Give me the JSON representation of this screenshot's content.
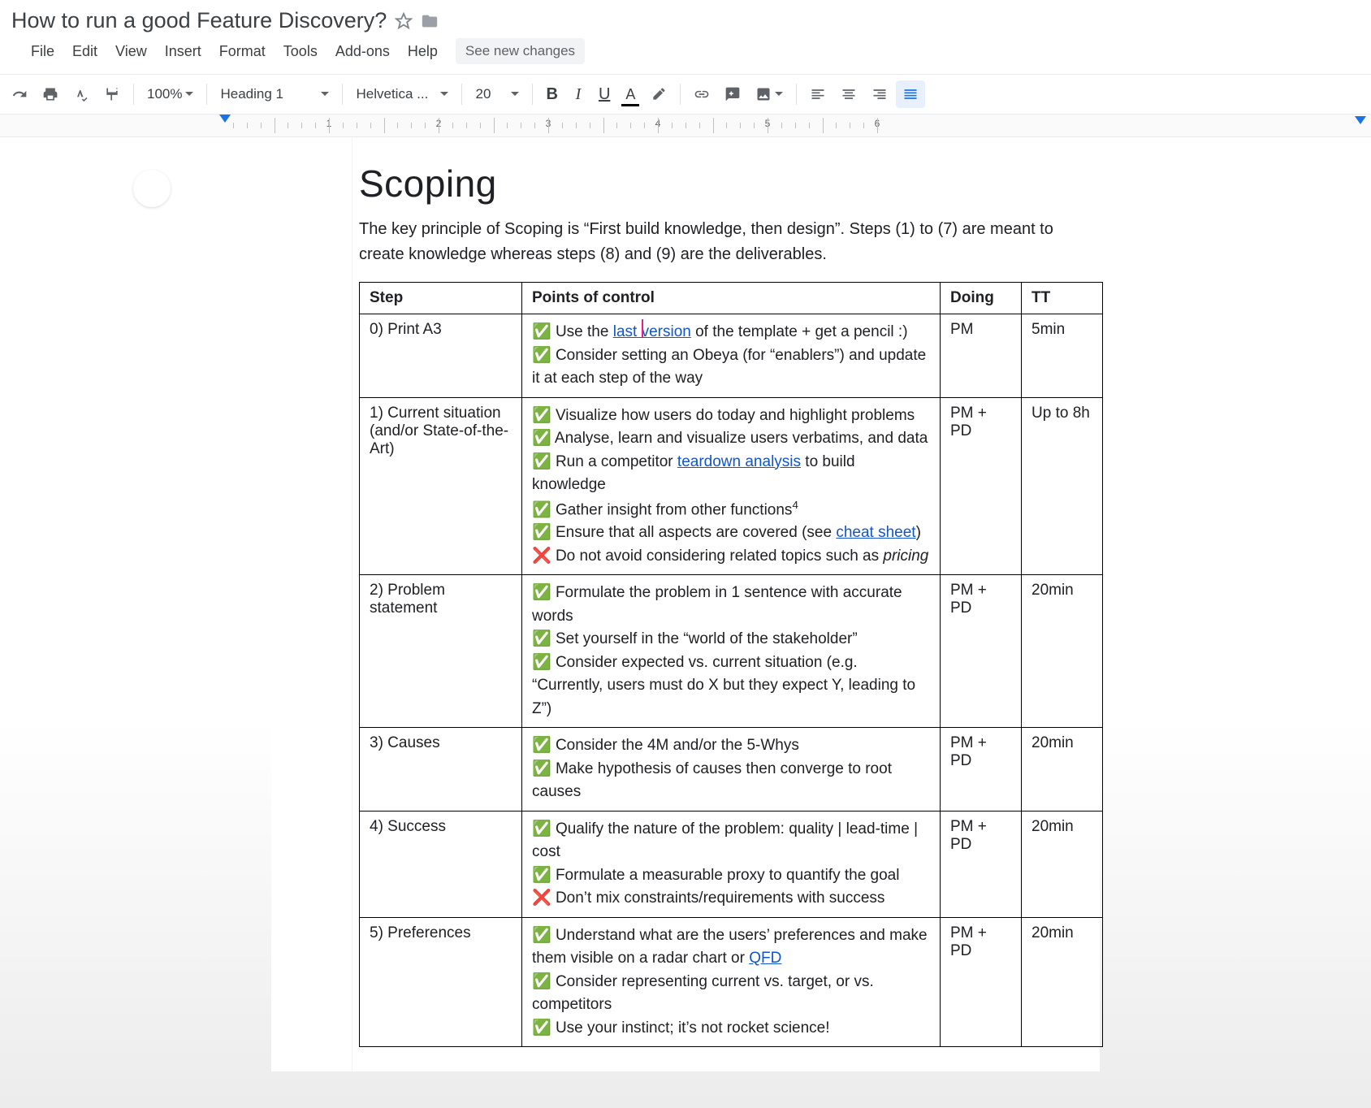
{
  "doc": {
    "title": "How to run a good Feature Discovery?",
    "star_tooltip": "Star",
    "folder_tooltip": "Move"
  },
  "menus": {
    "file": "File",
    "edit": "Edit",
    "view": "View",
    "insert": "Insert",
    "format": "Format",
    "tools": "Tools",
    "addons": "Add-ons",
    "help": "Help",
    "changes": "See new changes"
  },
  "toolbar": {
    "zoom": "100%",
    "style": "Heading 1",
    "font": "Helvetica ...",
    "font_size": "20"
  },
  "ruler": {
    "labels": [
      "1",
      "2",
      "3",
      "4",
      "5",
      "6"
    ]
  },
  "content": {
    "heading": "Scoping",
    "intro": "The key principle of Scoping is “First build knowledge, then design”. Steps (1) to (7) are meant to create knowledge whereas steps (8) and (9) are the deliverables.",
    "columns": {
      "step": "Step",
      "points": "Points of control",
      "doing": "Doing",
      "tt": "TT"
    },
    "rows": [
      {
        "step": "0) Print A3",
        "doing": "PM",
        "tt": "5min",
        "points": [
          {
            "icon": "check",
            "pre": "Use the ",
            "link": "last version",
            "post": " of the template + get a pencil :)"
          },
          {
            "icon": "check",
            "text": "Consider setting an Obeya (for “enablers”) and update it at each step of the way"
          }
        ],
        "link_has_cursor": true
      },
      {
        "step": "1) Current situation (and/or State-of-the-Art)",
        "doing": "PM + PD",
        "tt": "Up to 8h",
        "points": [
          {
            "icon": "check",
            "text": "Visualize how users do today and highlight problems"
          },
          {
            "icon": "check",
            "text": "Analyse, learn and visualize users verbatims, and data"
          },
          {
            "icon": "check",
            "pre": "Run a competitor ",
            "link": "teardown analysis",
            "post": " to build knowledge"
          },
          {
            "icon": "check",
            "text_html": "Gather insight from other functions",
            "sup": "4"
          },
          {
            "icon": "check",
            "pre": "Ensure that all aspects are covered (see ",
            "link": "cheat sheet",
            "post": ")"
          },
          {
            "icon": "cross",
            "pre": "Do not avoid considering related topics such as ",
            "em": "pricing",
            "post": ""
          }
        ]
      },
      {
        "step": "2) Problem statement",
        "doing": "PM + PD",
        "tt": "20min",
        "points": [
          {
            "icon": "check",
            "text": "Formulate the problem in 1 sentence with accurate words"
          },
          {
            "icon": "check",
            "text": "Set yourself in the “world of the stakeholder”"
          },
          {
            "icon": "check",
            "text": "Consider expected vs. current situation (e.g. “Currently, users must do X but they expect Y, leading to Z”)"
          }
        ]
      },
      {
        "step": "3) Causes",
        "doing": "PM + PD",
        "tt": "20min",
        "points": [
          {
            "icon": "check",
            "text": "Consider the 4M and/or the 5-Whys"
          },
          {
            "icon": "check",
            "text": "Make hypothesis of causes then converge to root causes"
          }
        ]
      },
      {
        "step": "4) Success",
        "doing": "PM + PD",
        "tt": "20min",
        "points": [
          {
            "icon": "check",
            "text": "Qualify the nature of the problem: quality | lead-time | cost"
          },
          {
            "icon": "check",
            "text": "Formulate a measurable proxy to quantify the goal"
          },
          {
            "icon": "cross",
            "text": "Don’t mix constraints/requirements with success"
          }
        ]
      },
      {
        "step": "5) Preferences",
        "doing": "PM + PD",
        "tt": "20min",
        "points": [
          {
            "icon": "check",
            "pre": "Understand what are the users’ preferences and make them visible on a radar chart or ",
            "link": "QFD",
            "post": ""
          },
          {
            "icon": "check",
            "text": "Consider representing current vs. target, or vs. competitors"
          },
          {
            "icon": "check",
            "text": "Use your instinct; it’s not rocket science!"
          }
        ]
      }
    ]
  }
}
